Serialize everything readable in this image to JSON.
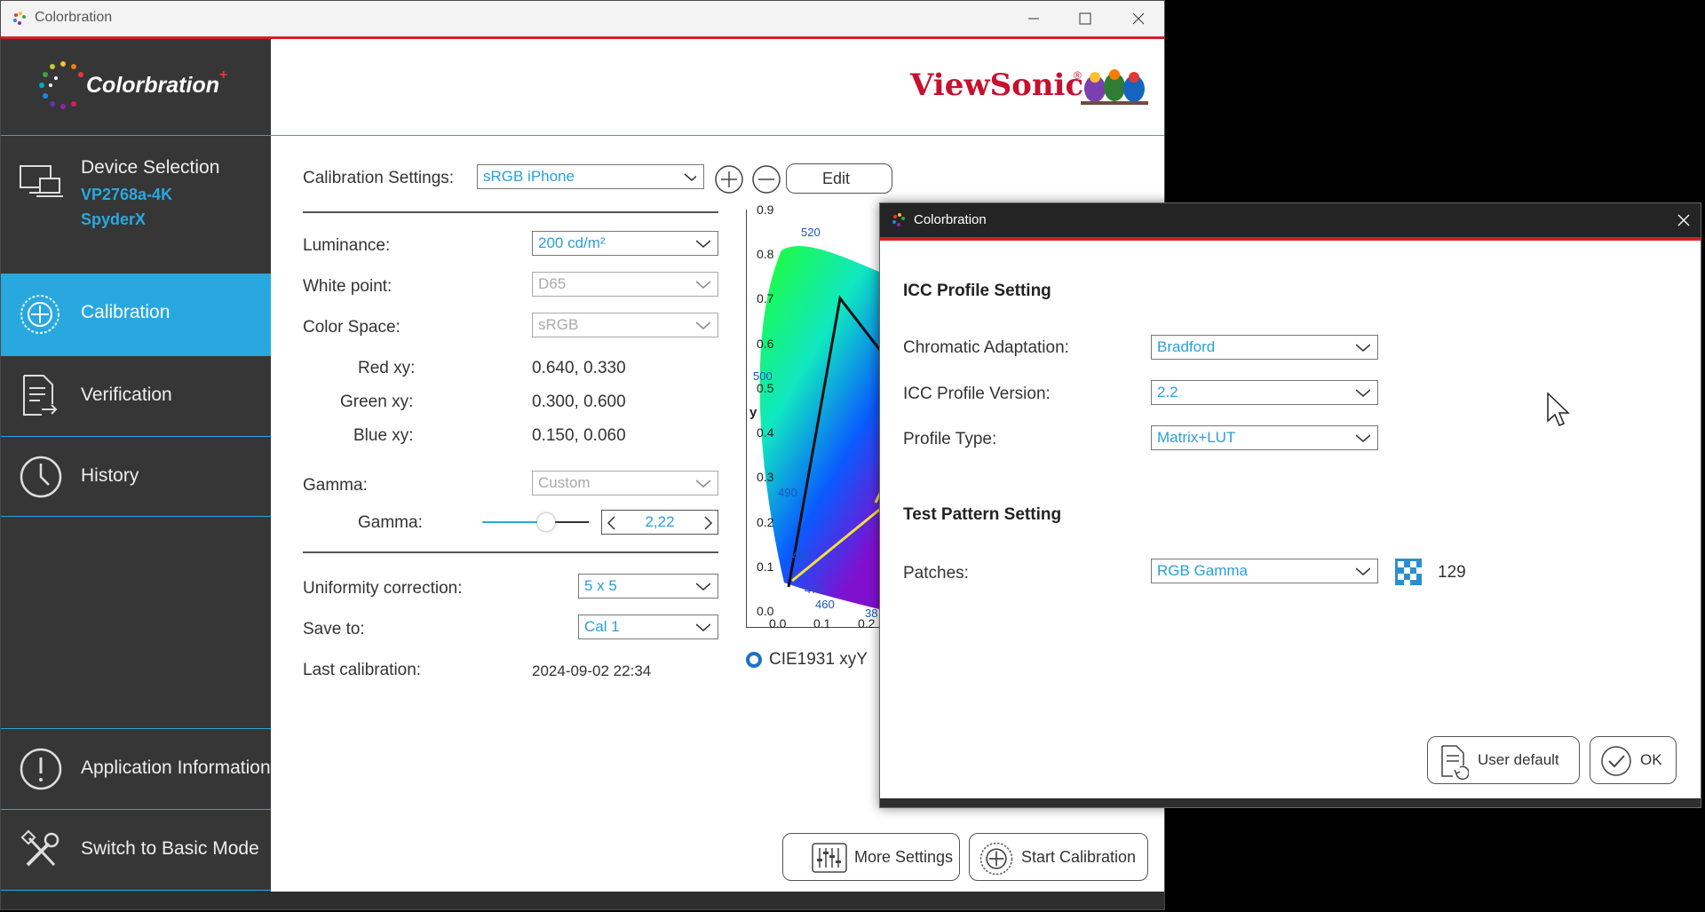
{
  "window": {
    "title": "Colorbration",
    "minimize_icon": "minimize-icon",
    "maximize_icon": "maximize-icon",
    "close_icon": "close-icon"
  },
  "brand": {
    "app_logo_text": "Colorbration",
    "vendor_logo_text": "ViewSonic",
    "vendor_reg": "®"
  },
  "sidebar": {
    "device": {
      "title": "Device Selection",
      "model": "VP2768a-4K",
      "sensor": "SpyderX",
      "icon": "monitor-laptop-icon"
    },
    "items": [
      {
        "label": "Calibration",
        "icon": "target-icon",
        "active": true
      },
      {
        "label": "Verification",
        "icon": "document-arrow-icon",
        "active": false
      },
      {
        "label": "History",
        "icon": "clock-icon",
        "active": false
      }
    ],
    "bottom_items": [
      {
        "label": "Application Information",
        "icon": "info-icon"
      },
      {
        "label": "Switch to Basic Mode",
        "icon": "tools-icon"
      }
    ]
  },
  "calibration": {
    "settings_label": "Calibration Settings:",
    "settings_value": "sRGB iPhone",
    "edit_label": "Edit",
    "luminance_label": "Luminance:",
    "luminance_value": "200 cd/m²",
    "whitepoint_label": "White point:",
    "whitepoint_value": "D65",
    "colorspace_label": "Color Space:",
    "colorspace_value": "sRGB",
    "red_label": "Red xy:",
    "red_value": "0.640, 0.330",
    "green_label": "Green xy:",
    "green_value": "0.300, 0.600",
    "blue_label": "Blue xy:",
    "blue_value": "0.150, 0.060",
    "gamma_label": "Gamma:",
    "gamma_value": "Custom",
    "gamma_slider_label": "Gamma:",
    "gamma_number": "2,22",
    "gamma_slider_level": 0.6,
    "uniformity_label": "Uniformity correction:",
    "uniformity_value": "5 x 5",
    "saveto_label": "Save to:",
    "saveto_value": "Cal 1",
    "last_label": "Last calibration:",
    "last_value": "2024-09-02 22:34",
    "more_settings": "More Settings",
    "start_calibration": "Start Calibration"
  },
  "chart": {
    "y_ticks": [
      "0.9",
      "0.8",
      "0.7",
      "0.6",
      "0.5",
      "0.4",
      "0.3",
      "0.2",
      "0.1",
      "0.0"
    ],
    "x_ticks": [
      "0.0",
      "0.1",
      "0.2"
    ],
    "y_label": "y",
    "wl_labels": [
      "520",
      "500",
      "490",
      "480",
      "470",
      "460",
      "38"
    ],
    "radio_label": "CIE1931 xyY"
  },
  "dialog": {
    "title": "Colorbration",
    "icc_heading": "ICC Profile Setting",
    "chromatic_label": "Chromatic Adaptation:",
    "chromatic_value": "Bradford",
    "icc_version_label": "ICC Profile Version:",
    "icc_version_value": "2.2",
    "profile_type_label": "Profile Type:",
    "profile_type_value": "Matrix+LUT",
    "test_heading": "Test Pattern Setting",
    "patches_label": "Patches:",
    "patches_value": "RGB Gamma",
    "patches_count": "129",
    "user_default": "User default",
    "ok": "OK"
  }
}
